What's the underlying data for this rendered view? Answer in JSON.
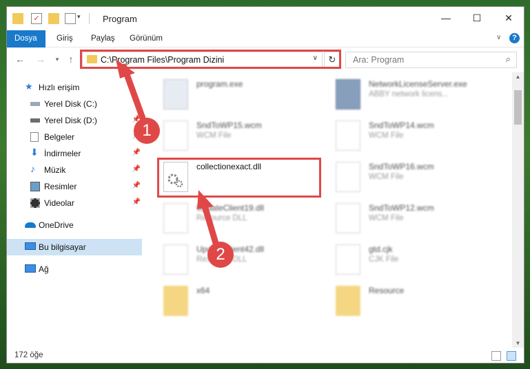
{
  "window": {
    "title": "Program",
    "minimize": "—",
    "maximize": "☐",
    "close": "✕"
  },
  "ribbon": {
    "tabs": [
      "Dosya",
      "Giriş",
      "Paylaş",
      "Görünüm"
    ],
    "help": "?"
  },
  "address": {
    "path": "C:\\Program Files\\Program Dizini",
    "search_placeholder": "Ara: Program"
  },
  "nav": {
    "items": [
      {
        "label": "Hızlı erişim",
        "icon": "star-icon"
      },
      {
        "label": "Yerel Disk (C:)",
        "icon": "drive-icon"
      },
      {
        "label": "Yerel Disk (D:)",
        "icon": "drive-icon"
      },
      {
        "label": "Belgeler",
        "icon": "documents-icon"
      },
      {
        "label": "İndirmeler",
        "icon": "download-icon"
      },
      {
        "label": "Müzik",
        "icon": "music-icon"
      },
      {
        "label": "Resimler",
        "icon": "pictures-icon"
      },
      {
        "label": "Videolar",
        "icon": "video-icon"
      },
      {
        "label": "OneDrive",
        "icon": "cloud-icon"
      },
      {
        "label": "Bu bilgisayar",
        "icon": "computer-icon"
      },
      {
        "label": "Ağ",
        "icon": "network-icon"
      }
    ]
  },
  "files": [
    {
      "name": "program.exe",
      "type": ""
    },
    {
      "name": "NetworkLicenseServer.exe",
      "type": "ABBY network licens..."
    },
    {
      "name": "SndToWP15.wcm",
      "type": "WCM File"
    },
    {
      "name": "SndToWP14.wcm",
      "type": "WCM File"
    },
    {
      "name": "collectionexact.dll",
      "type": ""
    },
    {
      "name": "SndToWP16.wcm",
      "type": "WCM File"
    },
    {
      "name": "UpdateClient19.dll",
      "type": "Resource DLL"
    },
    {
      "name": "SndToWP12.wcm",
      "type": "WCM File"
    },
    {
      "name": "UpdateClient42.dll",
      "type": "Resource DLL"
    },
    {
      "name": "gtd.cjk",
      "type": "CJK File"
    },
    {
      "name": "x64",
      "type": ""
    },
    {
      "name": "Resource",
      "type": ""
    }
  ],
  "status": {
    "count": "172 öğe"
  },
  "markers": {
    "one": "1",
    "two": "2"
  },
  "colors": {
    "accent": "#1979ca",
    "highlight_red": "#e04848",
    "selected_nav": "#cde3f5"
  }
}
